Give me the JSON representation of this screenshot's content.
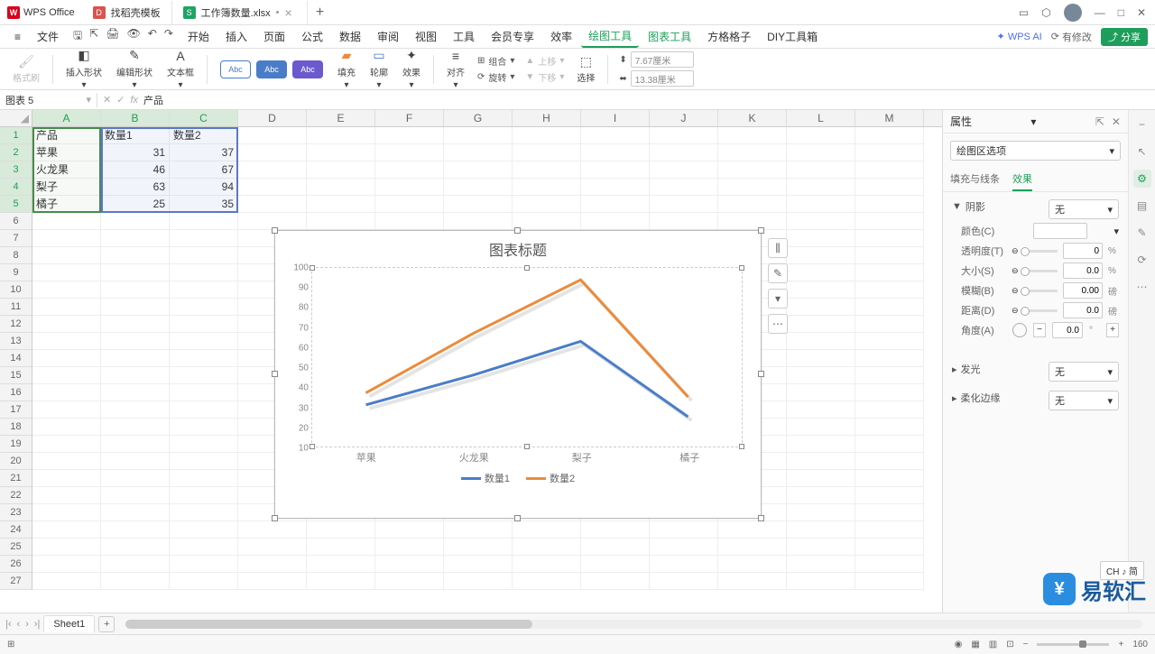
{
  "app": {
    "name": "WPS Office"
  },
  "tabs": [
    {
      "icon": "red",
      "label": "找稻壳模板"
    },
    {
      "icon": "green",
      "label": "工作簿数量.xlsx",
      "dirty": "•"
    }
  ],
  "window_controls": {
    "min": "—",
    "max": "□",
    "close": "✕"
  },
  "menus": {
    "file": "文件",
    "items": [
      "开始",
      "插入",
      "页面",
      "公式",
      "数据",
      "审阅",
      "视图",
      "工具",
      "会员专享",
      "效率",
      "绘图工具",
      "图表工具",
      "方格格子",
      "DIY工具箱"
    ],
    "active": "绘图工具",
    "wpsai": "WPS AI",
    "edit_flag": "有修改",
    "share": "分享"
  },
  "ribbon": {
    "format_painter": "格式刷",
    "insert_shape": "插入形状",
    "edit_shape": "编辑形状",
    "text_box": "文本框",
    "preset": "Abc",
    "fill": "填充",
    "outline": "轮廓",
    "effect": "效果",
    "align": "对齐",
    "group": "组合",
    "rotate": "旋转",
    "up": "上移",
    "down": "下移",
    "select": "选择",
    "height_label": "高",
    "width_label": "宽",
    "height": "7.67厘米",
    "width": "13.38厘米"
  },
  "formula_bar": {
    "name": "图表 5",
    "fx": "fx",
    "content": "产品"
  },
  "grid": {
    "cols": [
      "A",
      "B",
      "C",
      "D",
      "E",
      "F",
      "G",
      "H",
      "I",
      "J",
      "K",
      "L",
      "M"
    ],
    "rows": 27,
    "data": [
      [
        "产品",
        "数量1",
        "数量2"
      ],
      [
        "苹果",
        "31",
        "37"
      ],
      [
        "火龙果",
        "46",
        "67"
      ],
      [
        "梨子",
        "63",
        "94"
      ],
      [
        "橘子",
        "25",
        "35"
      ]
    ]
  },
  "chart_data": {
    "type": "line",
    "title": "图表标题",
    "categories": [
      "苹果",
      "火龙果",
      "梨子",
      "橘子"
    ],
    "series": [
      {
        "name": "数量1",
        "values": [
          31,
          46,
          63,
          25
        ],
        "color": "#4a7dc7"
      },
      {
        "name": "数量2",
        "values": [
          37,
          67,
          94,
          35
        ],
        "color": "#ec8b3a"
      }
    ],
    "ylim": [
      10,
      100
    ],
    "yticks": [
      10,
      20,
      30,
      40,
      50,
      60,
      70,
      80,
      90,
      100
    ],
    "xlabel": "",
    "ylabel": ""
  },
  "chart_buttons": [
    "chart-elements",
    "chart-style",
    "chart-filter",
    "chart-more"
  ],
  "properties": {
    "title": "属性",
    "target": "绘图区选项",
    "tabs": {
      "fill": "填充与线条",
      "effect": "效果"
    },
    "shadow": {
      "label": "阴影",
      "preset": "无",
      "color": "颜色(C)",
      "transparency": "透明度(T)",
      "size": "大小(S)",
      "blur": "模糊(B)",
      "distance": "距离(D)",
      "angle": "角度(A)",
      "transparency_val": "0",
      "size_val": "0.0",
      "blur_val": "0.00",
      "distance_val": "0.0",
      "angle_val": "0.0",
      "pct": "%",
      "pt": "磅",
      "deg": "°"
    },
    "glow": {
      "label": "发光",
      "preset": "无"
    },
    "soft": {
      "label": "柔化边缘",
      "preset": "无"
    }
  },
  "sheets": {
    "name": "Sheet1"
  },
  "status": {
    "zoom": "160"
  },
  "watermark": "易软汇",
  "ime": "CH ♪ 简"
}
